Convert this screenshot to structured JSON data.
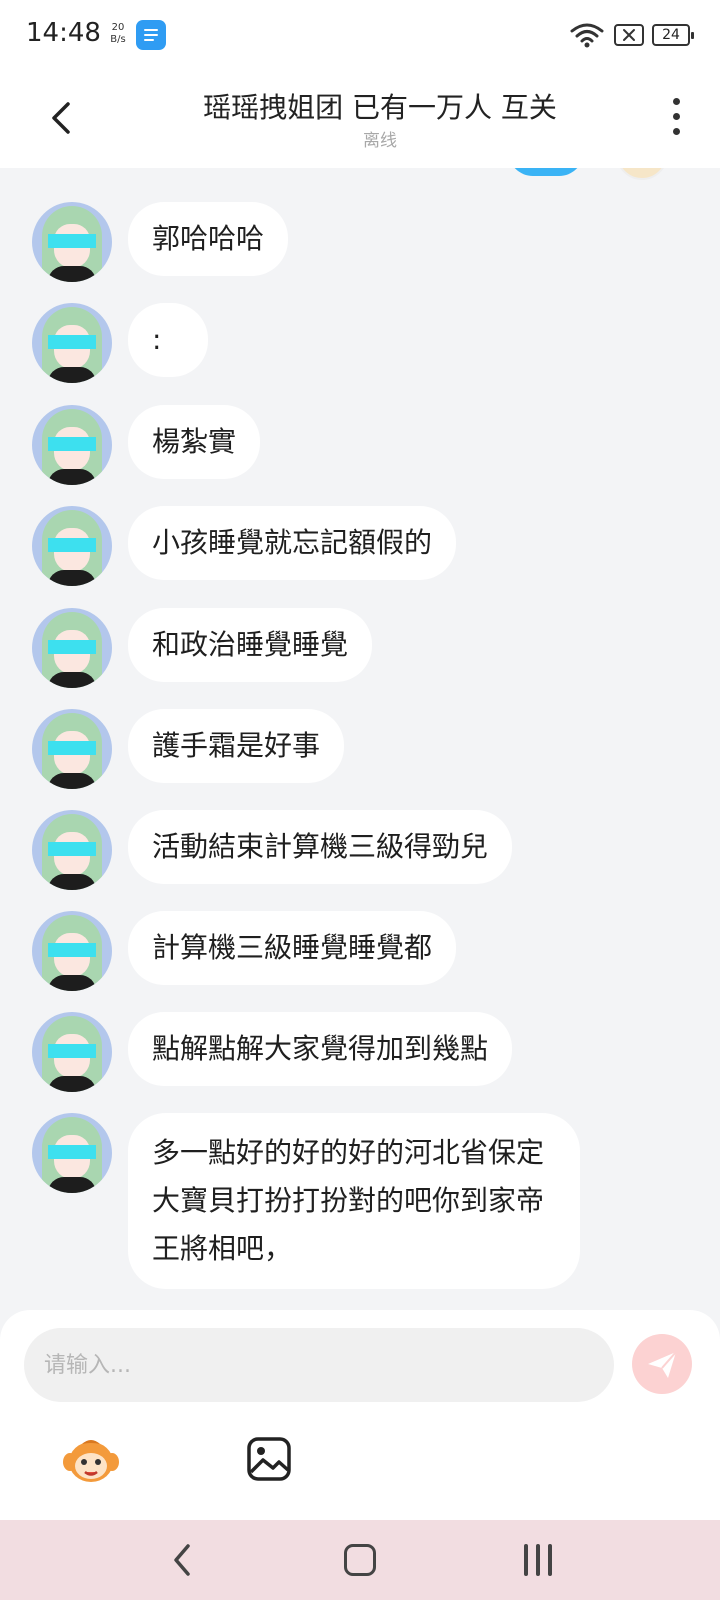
{
  "status_bar": {
    "time": "14:48",
    "net_speed_value": "20",
    "net_speed_unit": "B/s",
    "battery": "24",
    "icons": [
      "notes-app-icon",
      "wifi-icon",
      "sim-card-icon",
      "battery-icon"
    ]
  },
  "header": {
    "title": "瑶瑶拽姐团 已有一万人 互关",
    "status": "离线",
    "icons": [
      "back-arrow-icon",
      "more-vertical-icon"
    ]
  },
  "messages": [
    {
      "sender": "other",
      "text": "郭哈哈哈"
    },
    {
      "sender": "other",
      "text": ":"
    },
    {
      "sender": "other",
      "text": "楊紮實"
    },
    {
      "sender": "other",
      "text": "小孩睡覺就忘記額假的"
    },
    {
      "sender": "other",
      "text": "和政治睡覺睡覺"
    },
    {
      "sender": "other",
      "text": "護手霜是好事"
    },
    {
      "sender": "other",
      "text": "活動結束計算機三級得勁兒"
    },
    {
      "sender": "other",
      "text": "計算機三級睡覺睡覺都"
    },
    {
      "sender": "other",
      "text": "點解點解大家覺得加到幾點"
    },
    {
      "sender": "other",
      "text": "多一點好的好的好的河北省保定大寶貝打扮打扮對的吧你到家帝王將相吧，"
    }
  ],
  "composer": {
    "placeholder": "请输入...",
    "value": "",
    "icons": [
      "send-icon",
      "emoji-sticker-icon",
      "image-icon"
    ]
  },
  "colors": {
    "outgoing_bubble": "#3ab3f5",
    "send_button": "#fcd2d2",
    "nav_bar": "#f2dde1",
    "chat_background": "#f3f4f6"
  },
  "nav_bar": {
    "icons": [
      "nav-back-icon",
      "nav-home-icon",
      "nav-recents-icon"
    ]
  }
}
